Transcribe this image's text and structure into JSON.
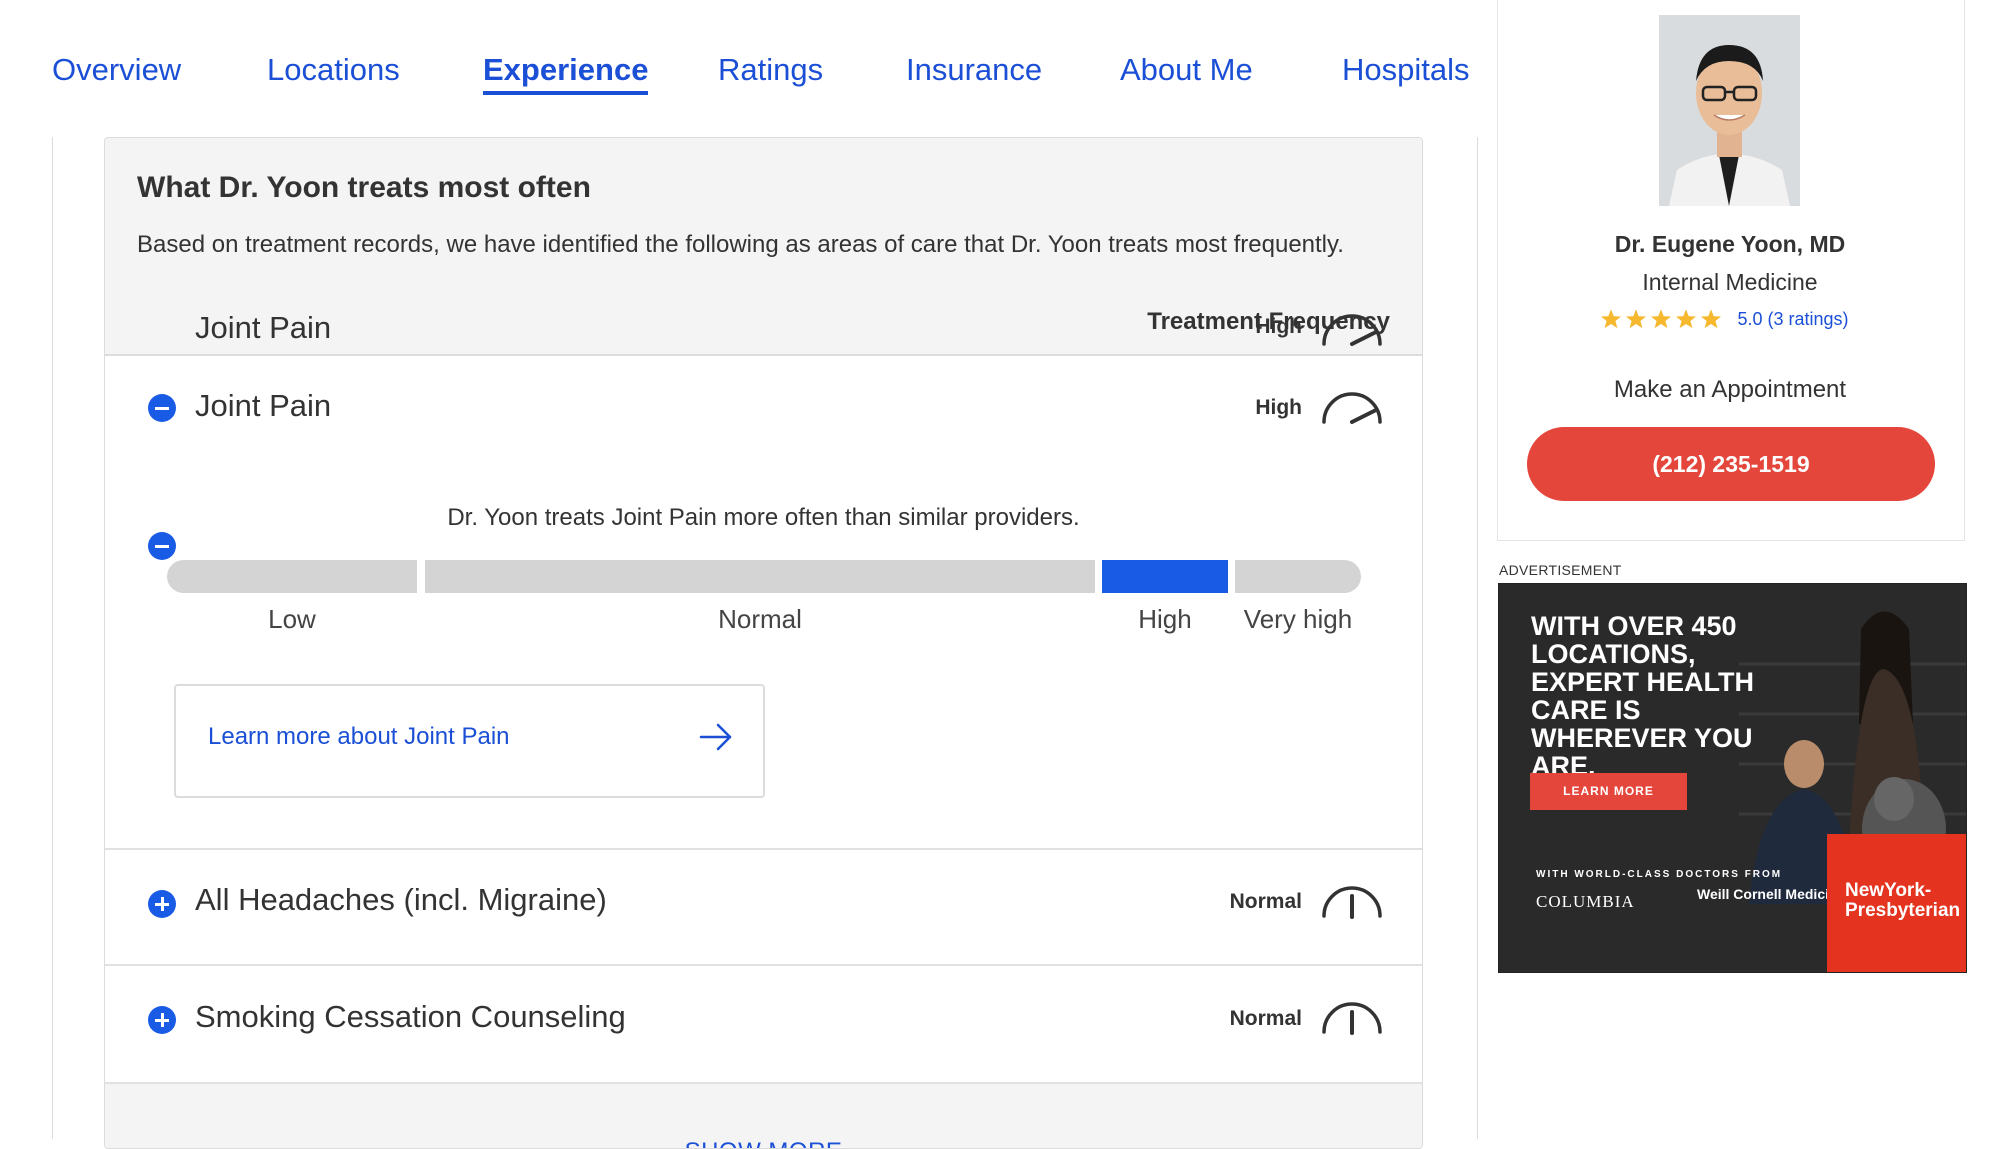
{
  "nav": {
    "tabs": [
      {
        "label": "Overview"
      },
      {
        "label": "Locations"
      },
      {
        "label": "Experience",
        "active": true
      },
      {
        "label": "Ratings"
      },
      {
        "label": "Insurance"
      },
      {
        "label": "About Me"
      },
      {
        "label": "Hospitals"
      }
    ]
  },
  "treats": {
    "title": "What Dr. Yoon treats most often",
    "description": "Based on treatment records, we have identified the following as areas of care that Dr. Yoon treats most frequently.",
    "frequency_heading": "Treatment Frequency",
    "conditions": [
      {
        "name": "Joint Pain",
        "level": "High",
        "expanded": true
      },
      {
        "name": "All Headaches (incl. Migraine)",
        "level": "Normal",
        "expanded": false
      },
      {
        "name": "Smoking Cessation Counseling",
        "level": "Normal",
        "expanded": false
      }
    ],
    "detail": {
      "comparison": "Dr. Yoon treats Joint Pain more often than similar providers.",
      "scale": [
        "Low",
        "Normal",
        "High",
        "Very high"
      ],
      "active_level": "High",
      "learn_more": "Learn more about Joint Pain"
    },
    "show_more": "SHOW MORE"
  },
  "profile": {
    "name": "Dr. Eugene Yoon, MD",
    "specialty": "Internal Medicine",
    "rating": 5.0,
    "rating_text": "5.0 (3 ratings)",
    "appointment_label": "Make an Appointment",
    "phone": "(212) 235-1519"
  },
  "ad": {
    "label": "ADVERTISEMENT",
    "headline": "WITH OVER 450 LOCATIONS, EXPERT HEALTH CARE IS WHEREVER YOU ARE.",
    "cta": "LEARN MORE",
    "tagline": "WITH WORLD-CLASS DOCTORS FROM",
    "logo_columbia": "COLUMBIA",
    "logo_weill": "Weill Cornell Medicine",
    "logo_nyp": "NewYork-Presbyterian"
  },
  "colors": {
    "link_blue": "#1a4fd6",
    "accent_blue": "#1a5be6",
    "phone_red": "#e4463c",
    "star_gold": "#f5b82e"
  },
  "icons": {
    "expanded_toggle": "minus-circle-icon",
    "collapsed_toggle": "plus-circle-icon",
    "gauge": "speedometer-icon",
    "arrow": "arrow-right-icon",
    "rating": "star-icon"
  }
}
